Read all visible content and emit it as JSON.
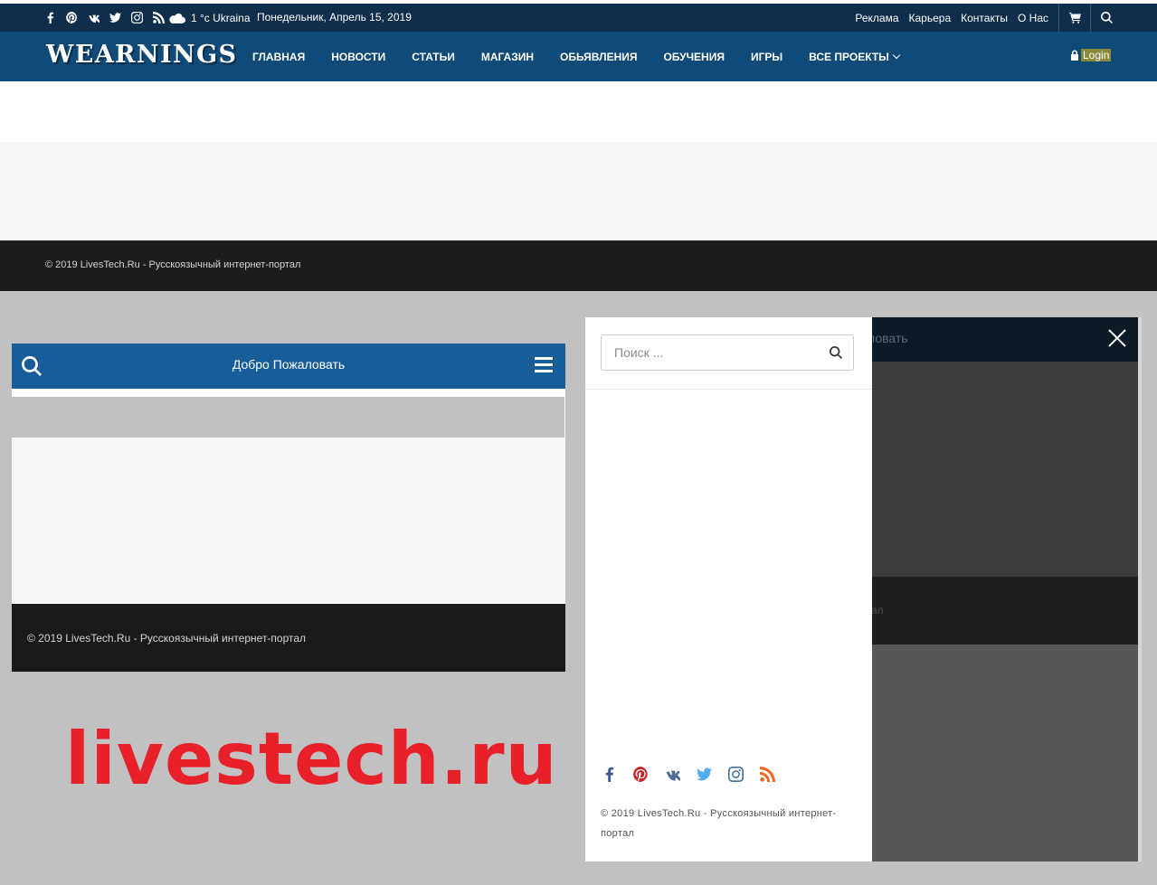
{
  "topbar": {
    "weather": "1 °c Ukraina",
    "date": "Понедельник, Апрель 15, 2019",
    "links": [
      "Реклама",
      "Карьера",
      "Контакты",
      "О Нас"
    ]
  },
  "navbar": {
    "logo": "WEARNINGS",
    "items": [
      "ГЛАВНАЯ",
      "НОВОСТИ",
      "СТАТЬИ",
      "МАГАЗИН",
      "ОБЬЯВЛЕНИЯ",
      "ОБУЧЕНИЯ",
      "ИГРЫ",
      "ВСЕ ПРОЕКТЫ"
    ],
    "login": "Login"
  },
  "footer": {
    "copyright": "© 2019 LivesTech.Ru - Русскоязычный интернет-портал"
  },
  "mobile": {
    "title": "Добро Пожаловать",
    "footer": "© 2019 LivesTech.Ru - Русскоязычный интернет-портал"
  },
  "offcanvas": {
    "search_placeholder": "Поиск ...",
    "behind_title": "ловать",
    "behind_footer": "ал",
    "copyright": "© 2019 LivesTech.Ru - Русскоязычный интернет-портал"
  },
  "watermark": "livestech.ru",
  "icons": {
    "social": [
      "facebook-icon",
      "pinterest-icon",
      "vk-icon",
      "twitter-icon",
      "instagram-icon",
      "rss-icon"
    ]
  },
  "colors": {
    "topbar_bg": "#0e2e4b",
    "nav_bg": "#0f4a79",
    "mobile_header": "#175d99",
    "watermark": "#e8202a",
    "facebook": "#3b5998",
    "pinterest": "#cb2027",
    "vk": "#4c6c91",
    "twitter": "#55acee",
    "instagram": "#3f729b",
    "rss": "#f26522"
  }
}
